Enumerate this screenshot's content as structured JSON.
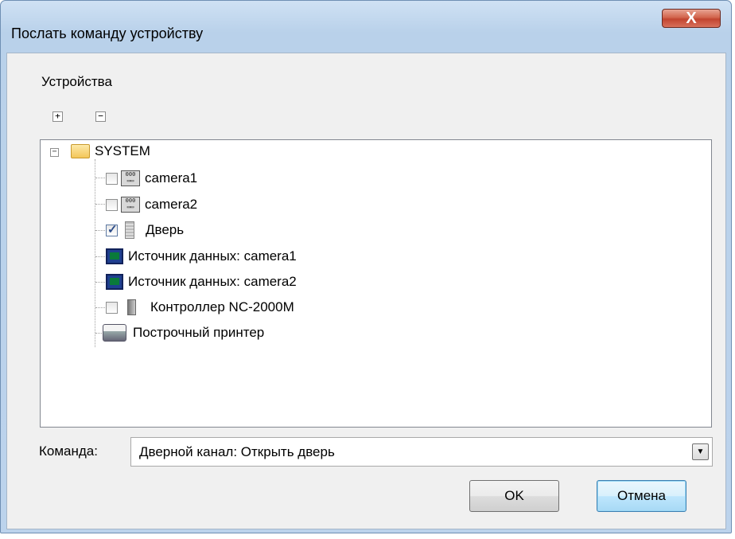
{
  "window": {
    "title": "Послать команду устройству",
    "close_label": "X"
  },
  "devices": {
    "group_label": "Устройства",
    "expand_all_label": "+",
    "collapse_all_label": "−",
    "tree": {
      "root": {
        "label": "SYSTEM",
        "expanded": true,
        "icon": "folder-icon"
      },
      "children": [
        {
          "label": "camera1",
          "checked": false,
          "has_checkbox": true,
          "icon": "camera-device-icon"
        },
        {
          "label": "camera2",
          "checked": false,
          "has_checkbox": true,
          "icon": "camera-device-icon"
        },
        {
          "label": "Дверь",
          "checked": true,
          "has_checkbox": true,
          "icon": "door-icon"
        },
        {
          "label": "Источник данных: camera1",
          "has_checkbox": false,
          "icon": "data-source-icon"
        },
        {
          "label": "Источник данных: camera2",
          "has_checkbox": false,
          "icon": "data-source-icon"
        },
        {
          "label": "Контроллер NC-2000M",
          "checked": false,
          "has_checkbox": true,
          "icon": "controller-icon"
        },
        {
          "label": "Построчный принтер",
          "has_checkbox": false,
          "icon": "printer-icon"
        }
      ]
    }
  },
  "command": {
    "label": "Команда:",
    "selected": "Дверной канал: Открыть дверь"
  },
  "buttons": {
    "ok": "OK",
    "cancel": "Отмена"
  }
}
